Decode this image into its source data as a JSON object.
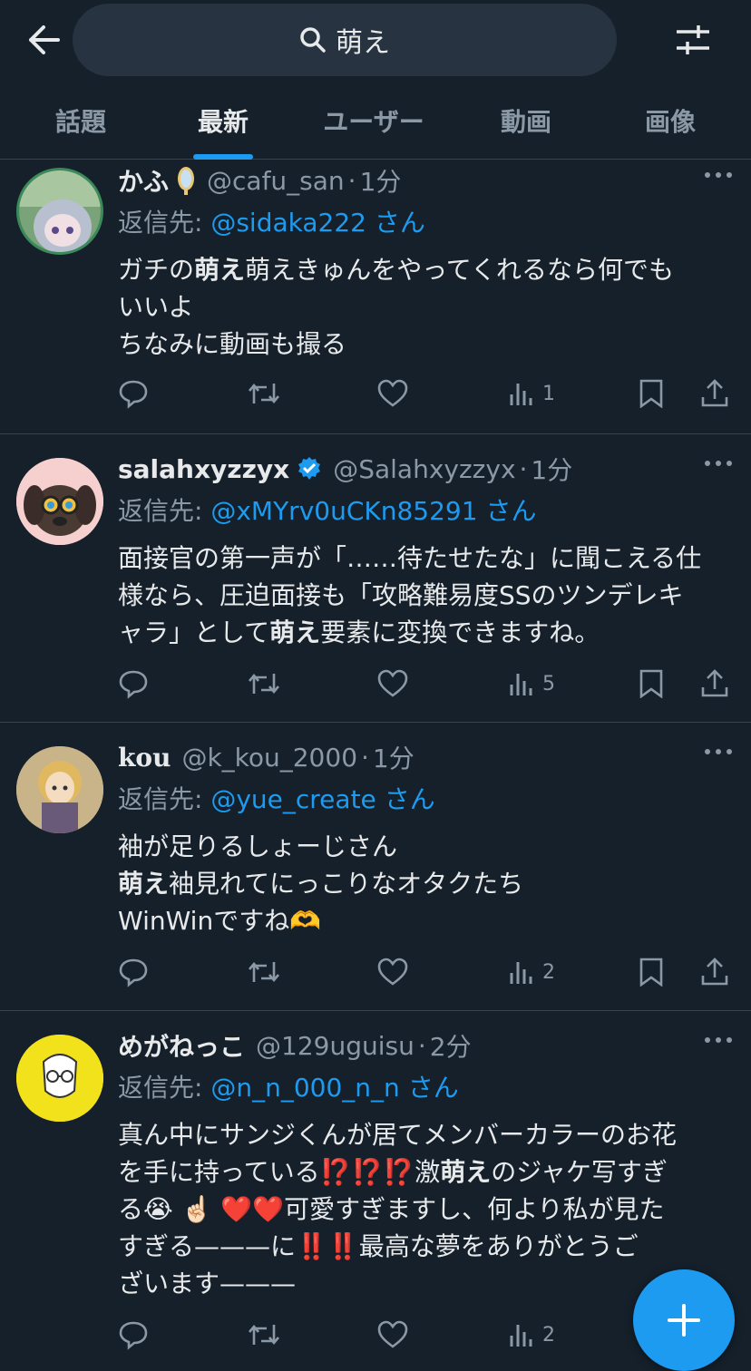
{
  "search": {
    "query": "萌え"
  },
  "tabs": [
    {
      "label": "話題",
      "active": false
    },
    {
      "label": "最新",
      "active": true
    },
    {
      "label": "ユーザー",
      "active": false
    },
    {
      "label": "動画",
      "active": false
    },
    {
      "label": "画像",
      "active": false
    }
  ],
  "tweets": [
    {
      "name": "かふ",
      "handle": "@cafu_san",
      "time": "1分",
      "reply_prefix": "返信先: ",
      "reply_to": "@sidaka222",
      "reply_suffix": "さん",
      "lines": [
        [
          {
            "t": "ガチの"
          },
          {
            "t": "萌え",
            "b": true
          },
          {
            "t": "萌えきゅんをやってくれるなら何でも"
          }
        ],
        [
          {
            "t": "いいよ"
          }
        ],
        [
          {
            "t": "ちなみに動画も撮る"
          }
        ]
      ],
      "views": "1"
    },
    {
      "name": "salahxyzzyx",
      "handle": "@Salahxyzzyx",
      "time": "1分",
      "reply_prefix": "返信先: ",
      "reply_to": "@xMYrv0uCKn85291",
      "reply_suffix": "さん",
      "lines": [
        [
          {
            "t": "面接官の第一声が「……待たせたな」に聞こえる仕"
          }
        ],
        [
          {
            "t": "様なら、圧迫面接も「攻略難易度SSのツンデレキ"
          }
        ],
        [
          {
            "t": "ャラ」として"
          },
          {
            "t": "萌え",
            "b": true
          },
          {
            "t": "要素に変換できますね。"
          }
        ]
      ],
      "views": "5"
    },
    {
      "name": "kou",
      "handle": "@k_kou_2000",
      "time": "1分",
      "reply_prefix": "返信先: ",
      "reply_to": "@yue_create",
      "reply_suffix": "さん",
      "lines": [
        [
          {
            "t": "袖が足りるしょーじさん"
          }
        ],
        [
          {
            "t": "萌え",
            "b": true
          },
          {
            "t": "袖見れてにっこりなオタクたち"
          }
        ],
        [
          {
            "t": "WinWinですね🫶"
          }
        ]
      ],
      "views": "2"
    },
    {
      "name": "めがねっこ",
      "handle": "@129uguisu",
      "time": "2分",
      "reply_prefix": "返信先: ",
      "reply_to": "@n_n_000_n_n",
      "reply_suffix": "さん",
      "lines": [
        [
          {
            "t": "真ん中にサンジくんが居てメンバーカラーのお花"
          }
        ],
        [
          {
            "t": "を手に持っている⁉️⁉️⁉️激"
          },
          {
            "t": "萌え",
            "b": true
          },
          {
            "t": "のジャケ写すぎ"
          }
        ],
        [
          {
            "t": "る😭 ☝🏻 ❤️❤️可愛すぎますし、何より私が見た"
          }
        ],
        [
          {
            "t": "すぎる———に‼️‼️最高な夢をありがとうご"
          }
        ],
        [
          {
            "t": "ざいます———"
          }
        ]
      ],
      "views": "2"
    }
  ],
  "colors": {
    "accent": "#1d9bf0",
    "background": "#15202b",
    "muted": "#8b98a5",
    "verified": "#1d9bf0"
  },
  "icons": [
    "back-arrow-icon",
    "search-icon",
    "filter-sliders-icon",
    "reply-icon",
    "retweet-icon",
    "like-icon",
    "views-icon",
    "bookmark-icon",
    "share-icon",
    "compose-plus-icon",
    "verified-badge-icon",
    "more-icon"
  ]
}
